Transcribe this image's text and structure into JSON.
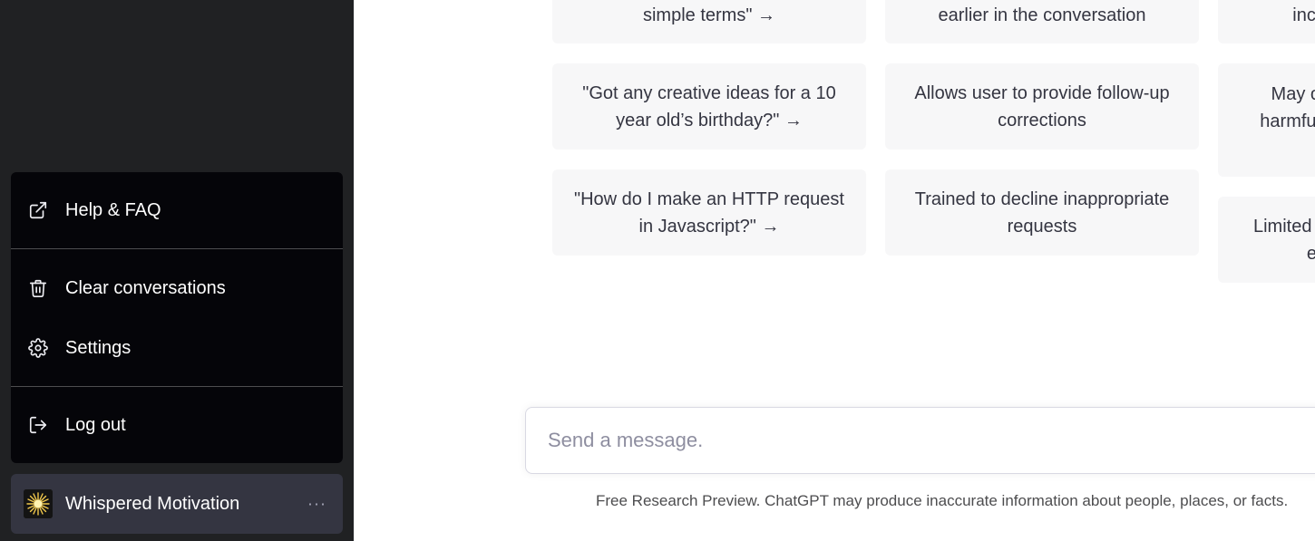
{
  "sidebar": {
    "menu": {
      "help": "Help & FAQ",
      "clear": "Clear conversations",
      "settings": "Settings",
      "logout": "Log out"
    },
    "user": {
      "name": "Whispered Motivation",
      "more": "···"
    }
  },
  "main": {
    "examples": [
      "simple terms\" →",
      "\"Got any creative ideas for a 10 year old’s birthday?\" →",
      "\"How do I make an HTTP request in Javascript?\" →"
    ],
    "capabilities": [
      "earlier in the conversation",
      "Allows user to provide follow-up corrections",
      "Trained to decline inappropriate requests"
    ],
    "limitations": [
      "inco",
      "May o harmful",
      "Limited k ev"
    ],
    "input": {
      "placeholder": "Send a message."
    },
    "footer": "Free Research Preview. ChatGPT may produce inaccurate information about people, places, or facts."
  },
  "colors": {
    "sidebar_bg": "#202123",
    "menu_bg": "#050509",
    "card_bg": "#f7f7f8",
    "text": "#343541"
  }
}
